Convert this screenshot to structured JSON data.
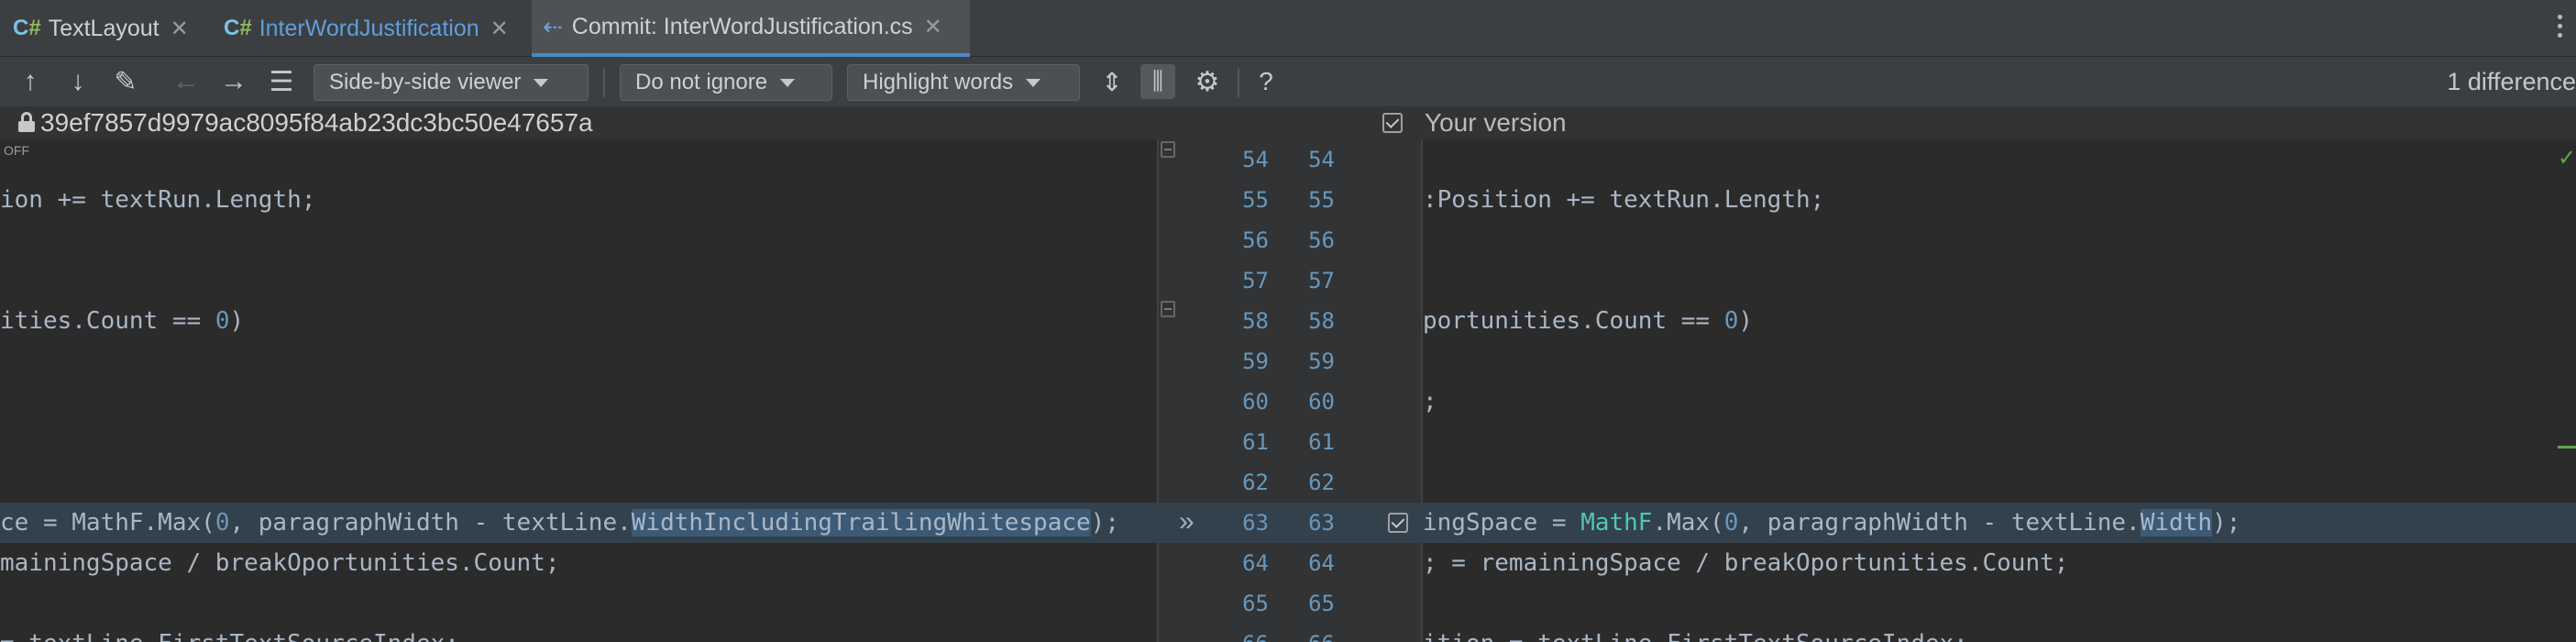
{
  "tabs": [
    {
      "icon": "C#",
      "label": "TextLayout",
      "active": false
    },
    {
      "icon": "C#",
      "label": "InterWordJustification",
      "active": false
    },
    {
      "icon": "commit",
      "label": "Commit: InterWordJustification.cs",
      "active": true
    }
  ],
  "toolbar": {
    "viewer": "Side-by-side viewer",
    "ignore": "Do not ignore",
    "highlight": "Highlight words",
    "diff_count": "1 difference"
  },
  "info": {
    "left_revision": "39ef7857d9979ac8095f84ab23dc3bc50e47657a",
    "right_label": "Your version",
    "off_label": "OFF"
  },
  "lines": [
    {
      "left_num": "54",
      "right_num": "54",
      "left": "",
      "right": ""
    },
    {
      "left_num": "55",
      "right_num": "55",
      "left": "ion += textRun.Length;",
      "right": ":Position += textRun.Length;"
    },
    {
      "left_num": "56",
      "right_num": "56",
      "left": "",
      "right": ""
    },
    {
      "left_num": "57",
      "right_num": "57",
      "left": "",
      "right": ""
    },
    {
      "left_num": "58",
      "right_num": "58",
      "left": "ities.Count == 0)",
      "right": "portunities.Count == 0)"
    },
    {
      "left_num": "59",
      "right_num": "59",
      "left": "",
      "right": ""
    },
    {
      "left_num": "60",
      "right_num": "60",
      "left": "",
      "right": ";"
    },
    {
      "left_num": "61",
      "right_num": "61",
      "left": "",
      "right": ""
    },
    {
      "left_num": "62",
      "right_num": "62",
      "left": "",
      "right": ""
    },
    {
      "left_num": "63",
      "right_num": "63",
      "left": "",
      "right": ""
    },
    {
      "left_num": "64",
      "right_num": "64",
      "left": "mainingSpace / breakOportunities.Count;",
      "right": "; = remainingSpace / breakOportunities.Count;"
    },
    {
      "left_num": "65",
      "right_num": "65",
      "left": "",
      "right": ""
    },
    {
      "left_num": "66",
      "right_num": "66",
      "left": "= textLine.FirstTextSourceIndex;",
      "right": "ition = textLine.FirstTextSourceIndex;"
    }
  ],
  "changed_line": {
    "left_pre": "ce = MathF.Max(",
    "left_zero": "0",
    "left_mid": ", paragraphWidth - textLine.",
    "left_word": "WidthIncludingTrailingWhitespace",
    "left_post": ");",
    "right_pre": "ingSpace = ",
    "right_cls": "MathF",
    "right_mid1": ".Max(",
    "right_zero": "0",
    "right_mid2": ", paragraphWidth - textLine.",
    "right_word": "Width",
    "right_post": ");"
  },
  "colors": {
    "accent": "#4a88c7",
    "number": "#6897bb",
    "highlight_line": "#33414d",
    "changed_word": "#3c5a76"
  }
}
